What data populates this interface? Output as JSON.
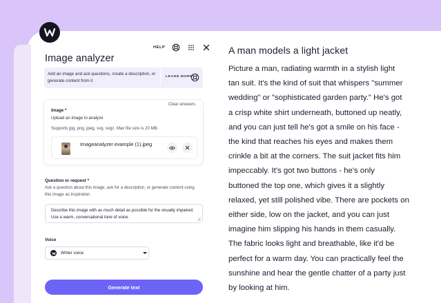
{
  "colors": {
    "background": "#d9c5f9",
    "accent": "#6c63f7",
    "info_bg": "#f1eefc",
    "dark": "#16151f"
  },
  "logo": {
    "icon": "writer-logo-icon"
  },
  "toolbar": {
    "help_label": "HELP",
    "icons": [
      "help-lifebuoy-icon",
      "apps-grid-icon",
      "close-icon"
    ]
  },
  "form": {
    "title": "Image analyzer",
    "info": {
      "text": "Add an image and ask questions, create a description, or generate content from it",
      "learn_more": "LEARN MORE"
    },
    "image": {
      "clear_label": "Clear answers",
      "label": "Image *",
      "instruction": "Upload an image to analyze",
      "hint": "Supports jpg, png, jpeg, svg, svgz. Max file size is 20 MB.",
      "file_name": "Imageanalyzer example (1).jpeg"
    },
    "question": {
      "label": "Question or request *",
      "hint": "Ask a question about this image, ask for a description, or generate content using this image as inspiration",
      "value": "Describe this image with as much detail as possible for the visually impaired. Use a warm, conversational tone of voice."
    },
    "voice": {
      "label": "Voice",
      "value": "Writer voice"
    },
    "submit_label": "Generate text"
  },
  "output": {
    "title": "A man models a light jacket",
    "lines": [
      "Picture a man, radiating warmth in a stylish light",
      "tan suit. It's the kind of suit that whispers \"summer",
      "wedding\" or \"sophisticated garden party.\" He's got",
      "a crisp white shirt underneath, buttoned up neatly,",
      "and you can just tell he's got a smile on his face -",
      "the kind that reaches his eyes and makes them",
      "crinkle a bit at the corners. The suit jacket fits him",
      "impeccably. It's got two buttons - he's only",
      "buttoned the top one, which gives it a slightly",
      "relaxed, yet still polished vibe. There are pockets on",
      "either side, low on the jacket, and you can just",
      "imagine him slipping his hands in them casually.",
      "The fabric looks light and breathable, like it'd be",
      "perfect for a warm day. You can practically feel the",
      "sunshine and hear the gentle chatter of a party just",
      "by looking at him."
    ]
  }
}
